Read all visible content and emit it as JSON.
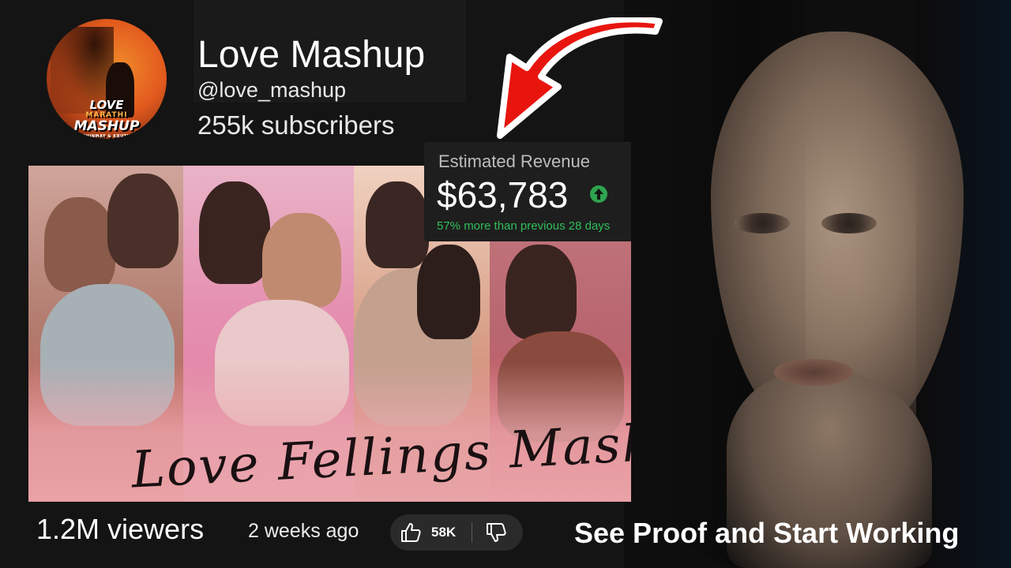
{
  "channel": {
    "logo_text": {
      "line1": "LOVE",
      "line2": "MARATHI",
      "line3": "MASHUP",
      "line4": "VISUAL CHINMAY & KRUTIKA RAUT"
    },
    "name": "Love Mashup",
    "handle": "@love_mashup",
    "subscribers": "255k subscribers"
  },
  "video": {
    "thumbnail_title": "Love Fellings Mashup",
    "views": "1.2M viewers",
    "age": "2 weeks ago",
    "likes": "58K"
  },
  "revenue": {
    "label": "Estimated Revenue",
    "value": "$63,783",
    "change": "57% more than previous 28 days",
    "trend_icon": "arrow-up-circle-icon",
    "trend_color": "#2ea44f"
  },
  "cta": "See Proof and Start Working",
  "colors": {
    "background": "#141414",
    "arrow": "#e8150f",
    "positive": "#2fbf5a"
  }
}
